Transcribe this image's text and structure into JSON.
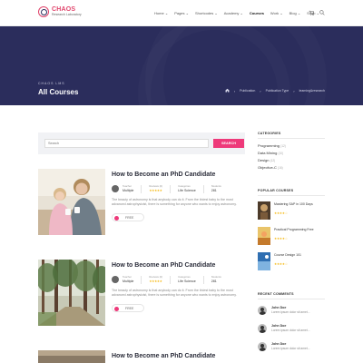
{
  "header": {
    "logo_title": "CHAOS",
    "logo_sub": "Research Laboratory",
    "nav": [
      "Home",
      "Pages",
      "Shortcodes",
      "Academy",
      "Courses",
      "Work",
      "Blog",
      "Shop"
    ],
    "nav_dropdown_glyph": "⌄",
    "cart_icon": "cart-icon",
    "search_icon": "search-icon"
  },
  "banner": {
    "subtitle": "CHAOS LMS",
    "title": "All Courses",
    "breadcrumbs": [
      "Publication",
      "Publication Type",
      "learning&research"
    ],
    "breadcrumb_home_icon": "home-icon"
  },
  "search": {
    "placeholder": "Search",
    "button": "SEARCH"
  },
  "courses": [
    {
      "title": "How to Become an PhD Candidate",
      "teacher_label": "Teacher",
      "teacher": "Multiple",
      "reviews_label": "Reviews (0)",
      "category_label": "Categories",
      "category": "Life Science",
      "students_label": "Students",
      "students": "281",
      "description": "The beauty of astronomy is that anybody can do it. From the tiniest baby to the most advanced astrophysicist, there is something for anyone who wants to enjoy astronomy.",
      "price": "FREE",
      "image": "mother-daughter-photo"
    },
    {
      "title": "How to Become an PhD Candidate",
      "teacher_label": "Teacher",
      "teacher": "Multiple",
      "reviews_label": "Reviews (0)",
      "category_label": "Categories",
      "category": "Life Science",
      "students_label": "Students",
      "students": "281",
      "description": "The beauty of astronomy is that anybody can do it. From the tiniest baby to the most advanced astrophysicist, there is something for anyone who wants to enjoy astronomy.",
      "price": "FREE",
      "image": "forest-path-photo"
    },
    {
      "title": "How to Become an PhD Candidate",
      "image": "generic-photo"
    }
  ],
  "sidebar": {
    "categories_heading": "CATEGORIES",
    "categories": [
      {
        "name": "Programming",
        "count": "(12)"
      },
      {
        "name": "Data Mining",
        "count": "(10)"
      },
      {
        "name": "Design",
        "count": "(12)"
      },
      {
        "name": "Objective-C",
        "count": "(16)"
      }
    ],
    "popular_heading": "POPULAR COURSES",
    "popular": [
      {
        "title": "Mastering SAP in 100 Days"
      },
      {
        "title": "Practical Programming Free"
      },
      {
        "title": "Course Design 101"
      }
    ],
    "recent_heading": "RECENT COMMENTS",
    "comments": [
      {
        "name": "John Doe",
        "text": "Lorem ipsum dolor sit amet..."
      },
      {
        "name": "John Doe",
        "text": "Lorem ipsum dolor sit amet..."
      },
      {
        "name": "John Doe",
        "text": "Lorem ipsum dolor sit amet..."
      }
    ]
  },
  "colors": {
    "brand_pink": "#ee3a7a",
    "banner_navy": "#2b2d5c",
    "star_gold": "#f5b400"
  }
}
